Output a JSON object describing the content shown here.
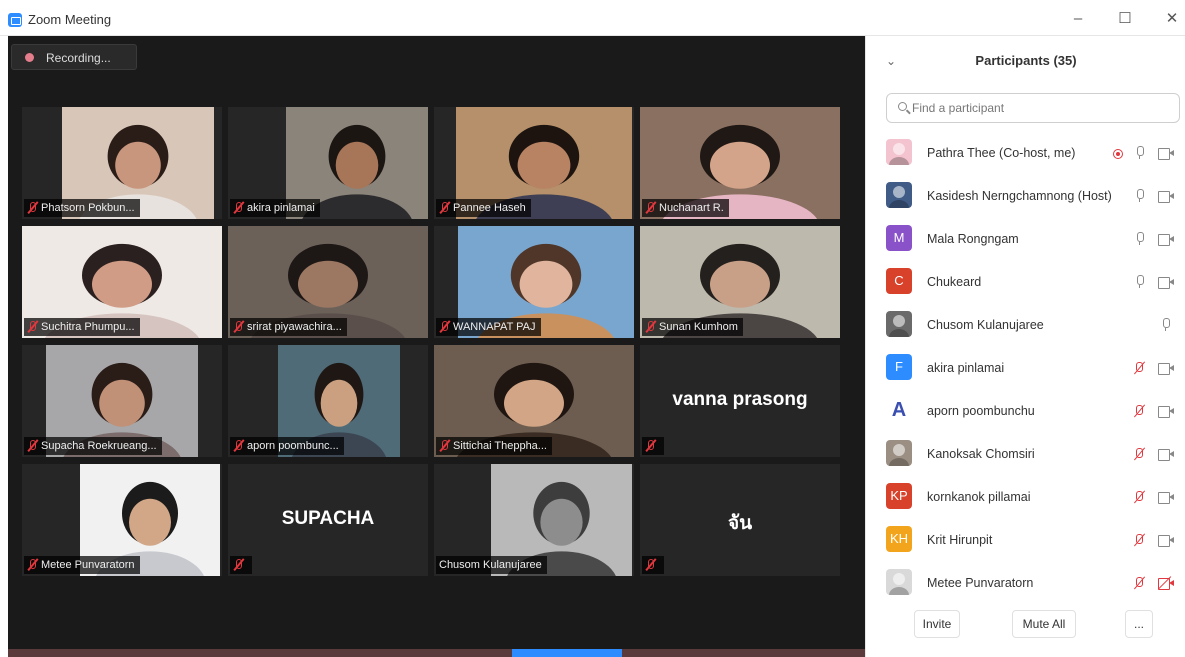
{
  "window": {
    "title": "Zoom Meeting",
    "minimize": "–",
    "maximize": "☐",
    "close": "✕"
  },
  "recording": {
    "label": "Recording..."
  },
  "tiles": [
    {
      "name": "Phatsorn Pokbun...",
      "type": "video",
      "bg": "#d8c6b8",
      "skin": "#c8957d",
      "hair": "#2a1d17",
      "shirt": "#e7e2dd"
    },
    {
      "name": "akira pinlamai",
      "type": "video",
      "bg": "#8b847b",
      "skin": "#a77558",
      "hair": "#1c1612",
      "shirt": "#2c2b2d"
    },
    {
      "name": "Pannee Haseh",
      "type": "video",
      "bg": "#b5906a",
      "skin": "#b88363",
      "hair": "#1d1410",
      "shirt": "#3e3f55"
    },
    {
      "name": "Nuchanart R.",
      "type": "video",
      "bg": "#8a7060",
      "skin": "#d4a48a",
      "hair": "#201814",
      "shirt": "#e6b5c4"
    },
    {
      "name": "Suchitra Phumpu...",
      "type": "video",
      "bg": "#efe9e5",
      "skin": "#d09c86",
      "hair": "#2b2020",
      "shirt": "#d6c4c0"
    },
    {
      "name": "srirat piyawachira...",
      "type": "video",
      "bg": "#6b6159",
      "skin": "#9c7762",
      "hair": "#1d1716",
      "shirt": "#5a4f4a"
    },
    {
      "name": "WANNAPAT PAJ",
      "type": "video",
      "bg": "#79a6cf",
      "skin": "#e0b49d",
      "hair": "#4f3628",
      "shirt": "#c9915e"
    },
    {
      "name": "Sunan Kumhom",
      "type": "video",
      "bg": "#bdb9ad",
      "skin": "#c8a088",
      "hair": "#24201d",
      "shirt": "#4b4644"
    },
    {
      "name": "Supacha Roekrueang...",
      "type": "video",
      "bg": "#a7a7aa",
      "skin": "#c09077",
      "hair": "#2a1c17",
      "shirt": "#7c6c6c"
    },
    {
      "name": "aporn poombunc...",
      "type": "video",
      "bg": "#4f6b78",
      "skin": "#caa080",
      "hair": "#1f1714",
      "shirt": "#3b4652"
    },
    {
      "name": "Sittichai Theppha...",
      "type": "video",
      "bg": "#6d5d50",
      "skin": "#d1a585",
      "hair": "#1f1511",
      "shirt": "#3a2c22"
    },
    {
      "name": "",
      "type": "name",
      "display": "vanna prasong"
    },
    {
      "name": "Metee Punvaratorn",
      "type": "video",
      "bg": "#f1f1f1",
      "skin": "#d1a787",
      "hair": "#1b1b1b",
      "shirt": "#c7c9cf"
    },
    {
      "name": "",
      "type": "name",
      "display": "SUPACHA"
    },
    {
      "name": "Chusom Kulanujaree",
      "type": "video",
      "bg": "#b9b9b9",
      "skin": "#8d8d8d",
      "hair": "#3d3d3d",
      "shirt": "#4a4a4a"
    },
    {
      "name": "",
      "type": "name",
      "display": "จัน"
    }
  ],
  "panel": {
    "title": "Participants (35)",
    "search_placeholder": "Find a participant",
    "participants": [
      {
        "name": "Pathra Thee (Co-host, me)",
        "avatar": "img",
        "color": "#f3c3cf",
        "recording": true,
        "mic": "on",
        "cam": "on"
      },
      {
        "name": "Kasidesh Nerngchamnong (Host)",
        "avatar": "img",
        "color": "#3f5b86",
        "recording": false,
        "mic": "on",
        "cam": "on"
      },
      {
        "name": "Mala Rongngam",
        "avatar": "M",
        "color": "#8a52c8",
        "recording": false,
        "mic": "on",
        "cam": "on"
      },
      {
        "name": "Chukeard",
        "avatar": "C",
        "color": "#d8412a",
        "recording": false,
        "mic": "on",
        "cam": "on"
      },
      {
        "name": "Chusom Kulanujaree",
        "avatar": "img",
        "color": "#6a6a6a",
        "recording": false,
        "mic": "on",
        "cam": "none"
      },
      {
        "name": "akira pinlamai",
        "avatar": "F",
        "color": "#2d8cff",
        "recording": false,
        "mic": "muted",
        "cam": "on"
      },
      {
        "name": "aporn poombunchu",
        "avatar": "A",
        "color": "#ffffff",
        "recording": false,
        "mic": "muted",
        "cam": "on"
      },
      {
        "name": "Kanoksak Chomsiri",
        "avatar": "img",
        "color": "#9b8f83",
        "recording": false,
        "mic": "muted",
        "cam": "on"
      },
      {
        "name": "kornkanok pillamai",
        "avatar": "KP",
        "color": "#d8412a",
        "recording": false,
        "mic": "muted",
        "cam": "on"
      },
      {
        "name": "Krit Hirunpit",
        "avatar": "KH",
        "color": "#f2a51c",
        "recording": false,
        "mic": "muted",
        "cam": "on"
      },
      {
        "name": "Metee Punvaratorn",
        "avatar": "img",
        "color": "#d9d9d9",
        "recording": false,
        "mic": "muted",
        "cam": "off"
      }
    ],
    "footer": {
      "invite": "Invite",
      "mute_all": "Mute All",
      "more": "..."
    }
  }
}
